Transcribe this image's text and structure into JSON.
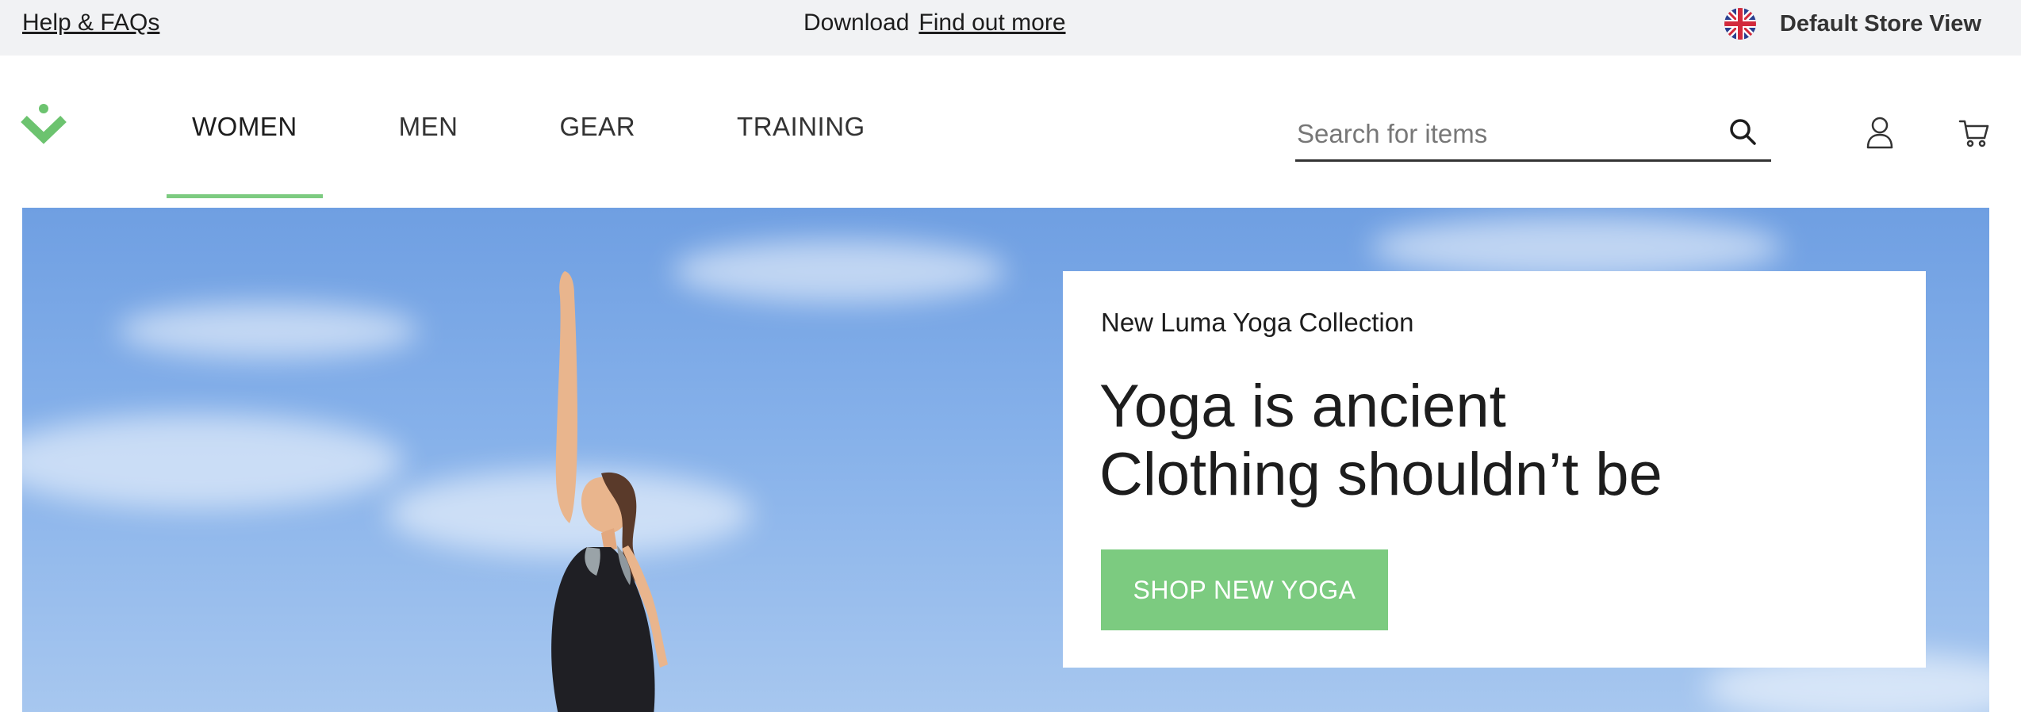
{
  "topbar": {
    "help_label": "Help & FAQs",
    "promo_text": "Download",
    "promo_link": "Find out more",
    "store_label": "Default Store View",
    "flag_icon": "uk-flag-icon"
  },
  "header": {
    "logo_icon": "brand-logo-icon",
    "nav": [
      {
        "label": "WOMEN",
        "active": true
      },
      {
        "label": "MEN",
        "active": false
      },
      {
        "label": "GEAR",
        "active": false
      },
      {
        "label": "TRAINING",
        "active": false
      }
    ],
    "search": {
      "placeholder": "Search for items",
      "value": "",
      "icon": "search-icon"
    },
    "account_icon": "user-icon",
    "cart_icon": "cart-icon"
  },
  "hero": {
    "eyebrow": "New Luma Yoga Collection",
    "headline_line1": "Yoga is ancient",
    "headline_line2": "Clothing shouldn’t be",
    "cta_label": "SHOP NEW YOGA"
  },
  "colors": {
    "accent": "#7ccb80",
    "topbar_bg": "#f1f2f4",
    "text": "#1d1d1d",
    "sky": "#86b1ea"
  }
}
